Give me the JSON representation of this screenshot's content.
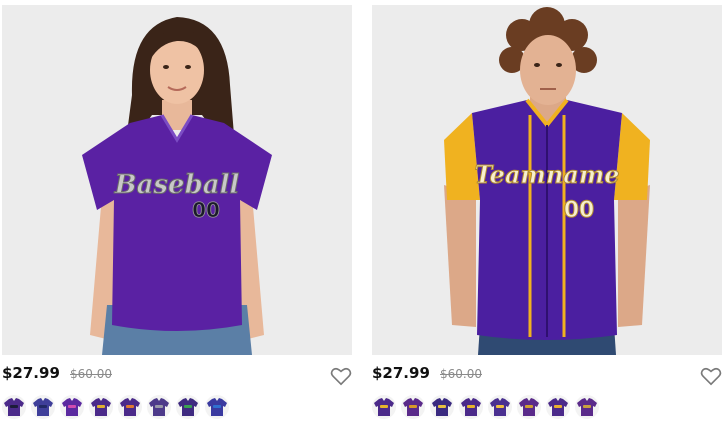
{
  "products": [
    {
      "jersey_text": "Baseball",
      "jersey_number": "00",
      "price": "$27.99",
      "old_price": "$60.00",
      "favorite_icon": "heart-outline-icon",
      "colors": {
        "body": "#5a21a3",
        "trim": "#b8b8b8",
        "sleeve": "#5a21a3",
        "background": "#ececec"
      },
      "swatches": [
        {
          "name": "purple-black",
          "primary": "#4b2a8a",
          "accent": "#1c1c3a"
        },
        {
          "name": "purple-navy",
          "primary": "#3f3f9a",
          "accent": "#222a66"
        },
        {
          "name": "purple-pink",
          "primary": "#5b2aa0",
          "accent": "#d04cb0"
        },
        {
          "name": "purple-gold",
          "primary": "#4b2a8a",
          "accent": "#e0b030"
        },
        {
          "name": "purple-orange",
          "primary": "#4b2a8a",
          "accent": "#e07a30"
        },
        {
          "name": "purple-gray",
          "primary": "#4d3a8a",
          "accent": "#9a9aa8"
        },
        {
          "name": "purple-green",
          "primary": "#3f2a80",
          "accent": "#3aa050"
        },
        {
          "name": "purple-blue",
          "primary": "#3a3aa0",
          "accent": "#3070d0"
        }
      ]
    },
    {
      "jersey_text": "Teamname",
      "jersey_number": "00",
      "price": "$27.99",
      "old_price": "$60.00",
      "favorite_icon": "heart-outline-icon",
      "colors": {
        "body": "#4b1fa0",
        "trim": "#f0b220",
        "sleeve": "#f0b220",
        "background": "#ececec"
      },
      "swatches": [
        {
          "name": "purple-gold-1",
          "primary": "#4b2a8a",
          "accent": "#e6b52a"
        },
        {
          "name": "purple-gold-2",
          "primary": "#5a2a8a",
          "accent": "#d89a28"
        },
        {
          "name": "purple-gold-3",
          "primary": "#3a2a80",
          "accent": "#e6c040"
        },
        {
          "name": "purple-gold-4",
          "primary": "#4b2a8a",
          "accent": "#e6b52a"
        },
        {
          "name": "purple-gold-5",
          "primary": "#4a3090",
          "accent": "#f0c040"
        },
        {
          "name": "purple-gold-6",
          "primary": "#5a2a8a",
          "accent": "#d0a030"
        },
        {
          "name": "purple-gold-7",
          "primary": "#4b2a8a",
          "accent": "#e8b030"
        },
        {
          "name": "purple-gold-8",
          "primary": "#5a2a8a",
          "accent": "#c9a040"
        }
      ]
    }
  ]
}
